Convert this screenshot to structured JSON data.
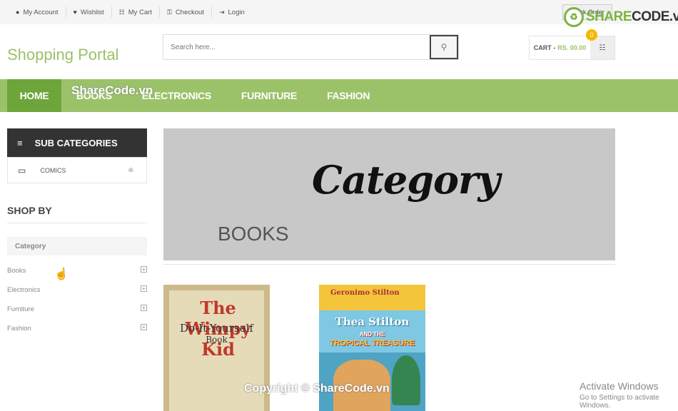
{
  "topbar": {
    "links": [
      {
        "icon": "user-icon",
        "glyph": "●",
        "label": "My Account"
      },
      {
        "icon": "heart-icon",
        "glyph": "♥",
        "label": "Wishlist"
      },
      {
        "icon": "cart-icon",
        "glyph": "☷",
        "label": "My Cart"
      },
      {
        "icon": "key-icon",
        "glyph": "⚿",
        "label": "Checkout"
      },
      {
        "icon": "login-icon",
        "glyph": "⇥",
        "label": "Login"
      }
    ],
    "track_label": "Track Order"
  },
  "watermark": {
    "logo_glyph": "♻",
    "share": "SHARE",
    "code": "CODE.vn",
    "nav_overlay": "ShareCode.vn",
    "copyright": "Copyright © ShareCode.vn"
  },
  "header": {
    "brand": "Shopping Portal",
    "search_placeholder": "Search here...",
    "search_icon_glyph": "⚲",
    "cart_label": "CART -",
    "cart_amount": "RS. 00.00",
    "cart_icon_glyph": "☷",
    "cart_count": "0"
  },
  "nav": {
    "items": [
      "HOME",
      "BOOKS",
      "ELECTRONICS",
      "FURNITURE",
      "FASHION"
    ],
    "active": "HOME"
  },
  "sidebar": {
    "sub_categories_title": "SUB CATEGORIES",
    "menu_glyph": "≡",
    "sub_items": [
      {
        "icon": "monitor-icon",
        "glyph": "▭",
        "label": "COMICS",
        "plus": "⊕"
      }
    ],
    "shop_by_title": "SHOP BY",
    "category_head": "Category",
    "categories": [
      "Books",
      "Electronics",
      "Furniture",
      "Fashion"
    ],
    "plus_glyph": "+"
  },
  "banner": {
    "script_text": "Category",
    "title": "BOOKS"
  },
  "products": [
    {
      "series": "The",
      "title": "Wimpy Kid",
      "subtitle": "Do-It-Yourself",
      "subtitle2": "Book"
    },
    {
      "series": "Geronimo Stilton",
      "title": "Thea Stilton",
      "subtitle": "AND THE",
      "subtitle2": "TROPICAL TREASURE"
    }
  ],
  "os_overlay": {
    "title": "Activate Windows",
    "subtitle": "Go to Settings to activate Windows."
  },
  "colors": {
    "accent_green": "#9bc269",
    "active_green": "#6ea53a",
    "dark_header": "#333333",
    "badge_yellow": "#f5b800"
  }
}
